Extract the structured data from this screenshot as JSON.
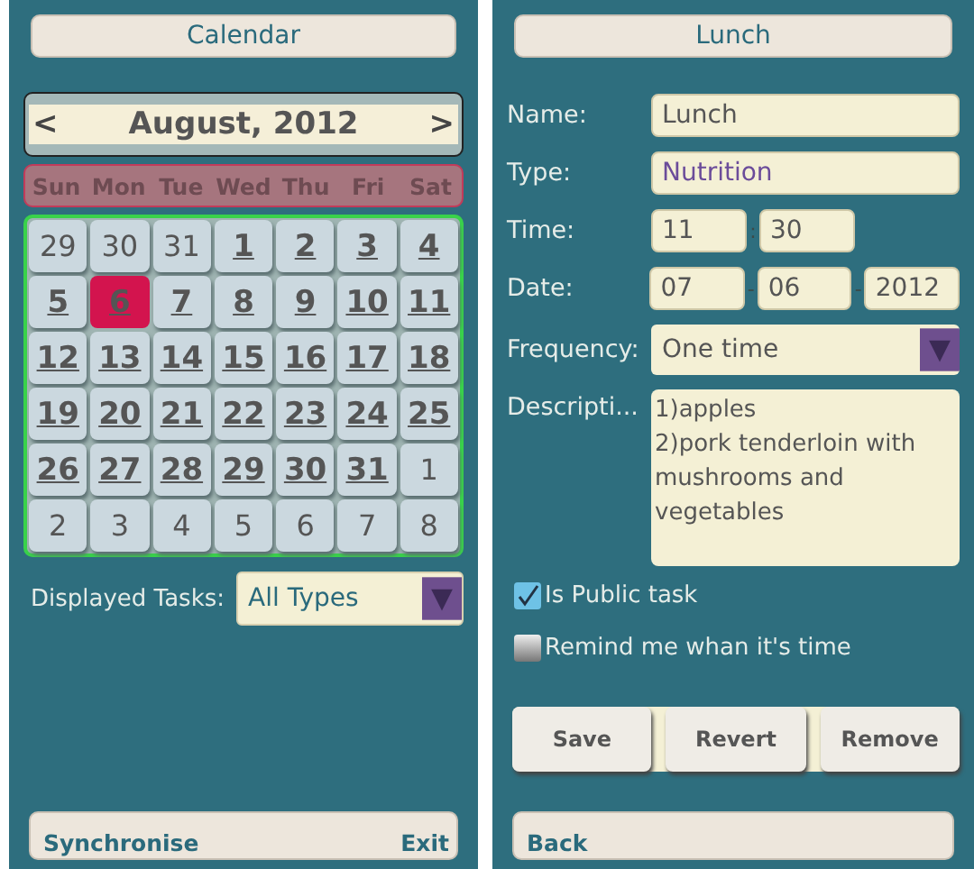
{
  "calendar_screen": {
    "title": "Calendar",
    "prev": "<",
    "month": "August, 2012",
    "next": ">",
    "weekdays": [
      "Sun",
      "Mon",
      "Tue",
      "Wed",
      "Thu",
      "Fri",
      "Sat"
    ],
    "days": [
      {
        "label": "29",
        "in_month": false,
        "selected": false
      },
      {
        "label": "30",
        "in_month": false,
        "selected": false
      },
      {
        "label": "31",
        "in_month": false,
        "selected": false
      },
      {
        "label": "1",
        "in_month": true,
        "selected": false
      },
      {
        "label": "2",
        "in_month": true,
        "selected": false
      },
      {
        "label": "3",
        "in_month": true,
        "selected": false
      },
      {
        "label": "4",
        "in_month": true,
        "selected": false
      },
      {
        "label": "5",
        "in_month": true,
        "selected": false
      },
      {
        "label": "6",
        "in_month": true,
        "selected": true
      },
      {
        "label": "7",
        "in_month": true,
        "selected": false
      },
      {
        "label": "8",
        "in_month": true,
        "selected": false
      },
      {
        "label": "9",
        "in_month": true,
        "selected": false
      },
      {
        "label": "10",
        "in_month": true,
        "selected": false
      },
      {
        "label": "11",
        "in_month": true,
        "selected": false
      },
      {
        "label": "12",
        "in_month": true,
        "selected": false
      },
      {
        "label": "13",
        "in_month": true,
        "selected": false
      },
      {
        "label": "14",
        "in_month": true,
        "selected": false
      },
      {
        "label": "15",
        "in_month": true,
        "selected": false
      },
      {
        "label": "16",
        "in_month": true,
        "selected": false
      },
      {
        "label": "17",
        "in_month": true,
        "selected": false
      },
      {
        "label": "18",
        "in_month": true,
        "selected": false
      },
      {
        "label": "19",
        "in_month": true,
        "selected": false
      },
      {
        "label": "20",
        "in_month": true,
        "selected": false
      },
      {
        "label": "21",
        "in_month": true,
        "selected": false
      },
      {
        "label": "22",
        "in_month": true,
        "selected": false
      },
      {
        "label": "23",
        "in_month": true,
        "selected": false
      },
      {
        "label": "24",
        "in_month": true,
        "selected": false
      },
      {
        "label": "25",
        "in_month": true,
        "selected": false
      },
      {
        "label": "26",
        "in_month": true,
        "selected": false
      },
      {
        "label": "27",
        "in_month": true,
        "selected": false
      },
      {
        "label": "28",
        "in_month": true,
        "selected": false
      },
      {
        "label": "29",
        "in_month": true,
        "selected": false
      },
      {
        "label": "30",
        "in_month": true,
        "selected": false
      },
      {
        "label": "31",
        "in_month": true,
        "selected": false
      },
      {
        "label": "1",
        "in_month": false,
        "selected": false
      },
      {
        "label": "2",
        "in_month": false,
        "selected": false
      },
      {
        "label": "3",
        "in_month": false,
        "selected": false
      },
      {
        "label": "4",
        "in_month": false,
        "selected": false
      },
      {
        "label": "5",
        "in_month": false,
        "selected": false
      },
      {
        "label": "6",
        "in_month": false,
        "selected": false
      },
      {
        "label": "7",
        "in_month": false,
        "selected": false
      },
      {
        "label": "8",
        "in_month": false,
        "selected": false
      }
    ],
    "filter": {
      "label": "Displayed Tasks:",
      "value": "All Types"
    },
    "bottom": {
      "left": "Synchronise",
      "right": "Exit"
    }
  },
  "task_screen": {
    "title": "Lunch",
    "name": {
      "label": "Name:",
      "value": "Lunch"
    },
    "type": {
      "label": "Type:",
      "value": "Nutrition"
    },
    "time": {
      "label": "Time:",
      "hour": "11",
      "sep": ":",
      "minute": "30"
    },
    "date": {
      "label": "Date:",
      "parts": [
        "07",
        "06",
        "2012"
      ],
      "sep": "-"
    },
    "frequency": {
      "label": "Frequency:",
      "value": "One time"
    },
    "description": {
      "label": "Descripti...",
      "lines": [
        "1)apples",
        "2)pork tenderloin with mushrooms and vegetables"
      ]
    },
    "options": [
      {
        "label": "Is Public task",
        "checked": true
      },
      {
        "label": "Remind me whan it's time",
        "checked": false
      }
    ],
    "buttons": [
      "Save",
      "Revert",
      "Remove"
    ],
    "back": "Back"
  }
}
